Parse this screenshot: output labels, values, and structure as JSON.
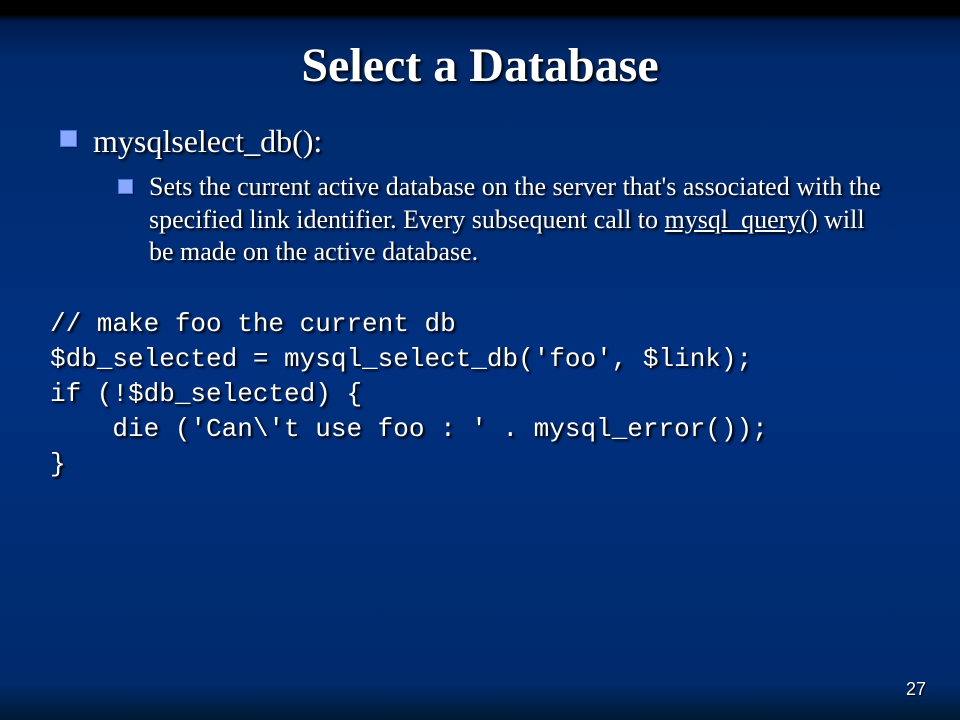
{
  "slide": {
    "title": "Select a Database",
    "bullets": {
      "l1": "mysqlselect_db():",
      "l2_pre": "Sets the current active database on the server that's associated with the specified link identifier. Every subsequent call to ",
      "l2_link": "mysql_query()",
      "l2_post": " will be made on the active database."
    },
    "code": "// make foo the current db\n$db_selected = mysql_select_db('foo', $link);\nif (!$db_selected) {\n    die ('Can\\'t use foo : ' . mysql_error());\n}",
    "page_number": "27"
  }
}
